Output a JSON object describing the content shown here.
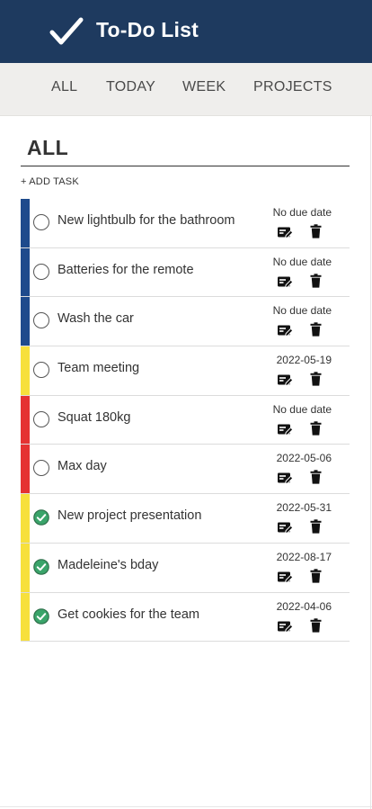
{
  "header": {
    "title": "To-Do List",
    "icon": "checkmark-icon",
    "background": "#1e3a5f"
  },
  "nav": {
    "tabs": [
      {
        "label": "ALL"
      },
      {
        "label": "TODAY"
      },
      {
        "label": "WEEK"
      },
      {
        "label": "PROJECTS"
      }
    ]
  },
  "main": {
    "title": "ALL",
    "add_task_label": "+ ADD TASK",
    "tasks": [
      {
        "name": "New lightbulb for the bathroom",
        "due": "No due date",
        "color": "#1e4a8c",
        "completed": false
      },
      {
        "name": "Batteries for the remote",
        "due": "No due date",
        "color": "#1e4a8c",
        "completed": false
      },
      {
        "name": "Wash the car",
        "due": "No due date",
        "color": "#1e4a8c",
        "completed": false
      },
      {
        "name": "Team meeting",
        "due": "2022-05-19",
        "color": "#f7e03c",
        "completed": false
      },
      {
        "name": "Squat 180kg",
        "due": "No due date",
        "color": "#e53232",
        "completed": false
      },
      {
        "name": "Max day",
        "due": "2022-05-06",
        "color": "#e53232",
        "completed": false
      },
      {
        "name": "New project presentation",
        "due": "2022-05-31",
        "color": "#f7e03c",
        "completed": true
      },
      {
        "name": "Madeleine's bday",
        "due": "2022-08-17",
        "color": "#f7e03c",
        "completed": true
      },
      {
        "name": "Get cookies for the team",
        "due": "2022-04-06",
        "color": "#f7e03c",
        "completed": true
      }
    ]
  },
  "colors": {
    "accent_green": "#3aa46a",
    "nav_bg": "#efeeec"
  }
}
